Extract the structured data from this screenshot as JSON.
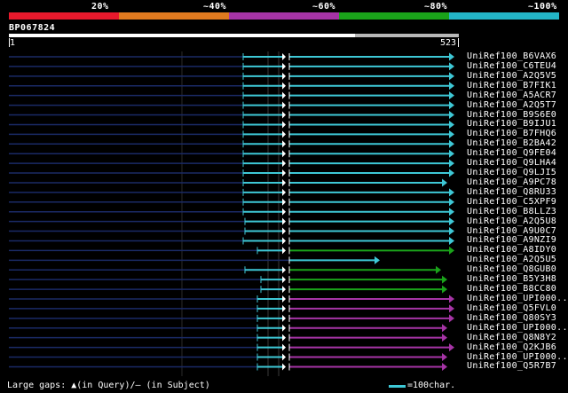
{
  "legend": [
    {
      "label": "20%",
      "color": "#e8192c"
    },
    {
      "label": "~40%",
      "color": "#e07a1f"
    },
    {
      "label": "~60%",
      "color": "#a634a6"
    },
    {
      "label": "~80%",
      "color": "#1aa31a"
    },
    {
      "label": "~100%",
      "color": "#23b5c7"
    }
  ],
  "query": {
    "id": "BP067824",
    "start": "1",
    "end": "523"
  },
  "hits": [
    {
      "name": "UniRef100_B6VAX6",
      "color": "#3ec8d6"
    },
    {
      "name": "UniRef100_C6TEU4",
      "color": "#3ec8d6"
    },
    {
      "name": "UniRef100_A2Q5V5",
      "color": "#3ec8d6"
    },
    {
      "name": "UniRef100_B7FIK1",
      "color": "#3ec8d6"
    },
    {
      "name": "UniRef100_A5ACR7",
      "color": "#3ec8d6"
    },
    {
      "name": "UniRef100_A2Q5T7",
      "color": "#3ec8d6"
    },
    {
      "name": "UniRef100_B9S6E0",
      "color": "#3ec8d6"
    },
    {
      "name": "UniRef100_B9IJU1",
      "color": "#3ec8d6"
    },
    {
      "name": "UniRef100_B7FHQ6",
      "color": "#3ec8d6"
    },
    {
      "name": "UniRef100_B2BA42",
      "color": "#3ec8d6"
    },
    {
      "name": "UniRef100_Q9FE04",
      "color": "#3ec8d6"
    },
    {
      "name": "UniRef100_Q9LHA4",
      "color": "#3ec8d6"
    },
    {
      "name": "UniRef100_Q9LJI5",
      "color": "#3ec8d6"
    },
    {
      "name": "UniRef100_A9PC78",
      "color": "#3ec8d6"
    },
    {
      "name": "UniRef100_Q8RU33",
      "color": "#3ec8d6"
    },
    {
      "name": "UniRef100_C5XPF9",
      "color": "#3ec8d6"
    },
    {
      "name": "UniRef100_B8LLZ3",
      "color": "#3ec8d6"
    },
    {
      "name": "UniRef100_A2Q5U8",
      "color": "#3ec8d6"
    },
    {
      "name": "UniRef100_A9U0C7",
      "color": "#3ec8d6"
    },
    {
      "name": "UniRef100_A9NZI9",
      "color": "#3ec8d6"
    },
    {
      "name": "UniRef100_A8IDY0",
      "color": "#1aa31a"
    },
    {
      "name": "UniRef100_A2Q5U5",
      "color": "#3ec8d6"
    },
    {
      "name": "UniRef100_Q8GUB0",
      "color": "#1aa31a"
    },
    {
      "name": "UniRef100_B5Y3H8",
      "color": "#1aa31a"
    },
    {
      "name": "UniRef100_B8CC80",
      "color": "#1aa31a"
    },
    {
      "name": "UniRef100_UPI000..",
      "color": "#a634a6"
    },
    {
      "name": "UniRef100_Q5FVL0",
      "color": "#a634a6"
    },
    {
      "name": "UniRef100_Q80SY3",
      "color": "#a634a6"
    },
    {
      "name": "UniRef100_UPI000..",
      "color": "#a634a6"
    },
    {
      "name": "UniRef100_Q8N8Y2",
      "color": "#a634a6"
    },
    {
      "name": "UniRef100_Q2KJB6",
      "color": "#a634a6"
    },
    {
      "name": "UniRef100_UPI000..",
      "color": "#a634a6"
    },
    {
      "name": "UniRef100_Q5R7B7",
      "color": "#a634a6"
    }
  ],
  "footer": {
    "gaps_text": "Large gaps: ▲(in Query)/– (in Subject)",
    "scale_text": "=100char."
  }
}
